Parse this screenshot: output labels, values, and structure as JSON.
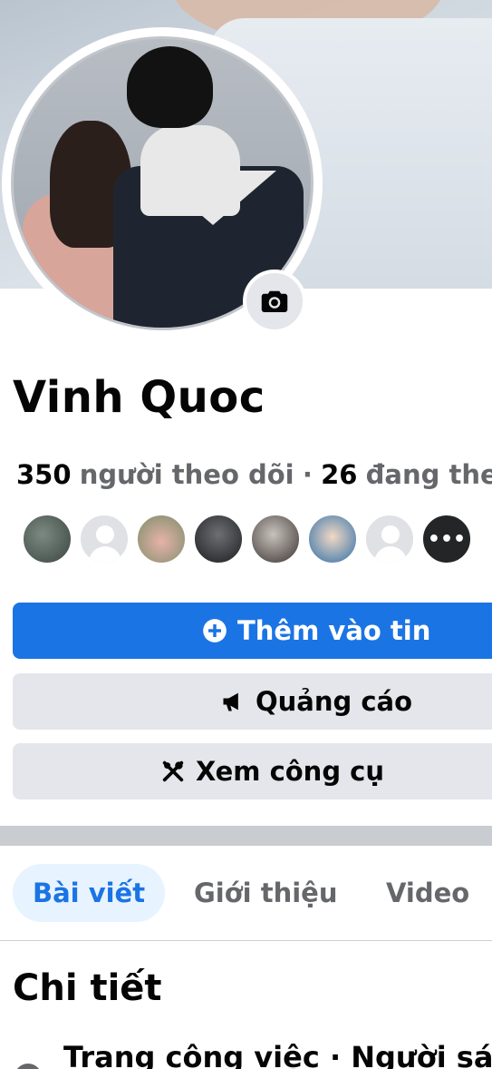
{
  "profile": {
    "name": "Vinh Quoc",
    "followers_count": "350",
    "followers_label": "người theo dõi",
    "separator": "·",
    "following_count": "26",
    "following_label": "đang theo dõi",
    "friends_more_glyph": "•••"
  },
  "actions": {
    "add_story": "Thêm vào tin",
    "ads": "Quảng cáo",
    "tools": "Xem công cụ"
  },
  "tabs": [
    {
      "label": "Bài viết",
      "active": true
    },
    {
      "label": "Giới thiệu",
      "active": false
    },
    {
      "label": "Video",
      "active": false
    }
  ],
  "details": {
    "title": "Chi tiết",
    "first_item": "Trang công việc · Người sáng tạo"
  },
  "colors": {
    "primary": "#1b74e4",
    "secondary_button": "#e4e6eb",
    "muted_text": "#65676b",
    "active_tab_bg": "#e7f3ff"
  },
  "icons": {
    "camera": "camera-icon",
    "plus": "plus-circle-icon",
    "megaphone": "megaphone-icon",
    "tools": "tools-icon",
    "more": "more-dots-icon"
  }
}
